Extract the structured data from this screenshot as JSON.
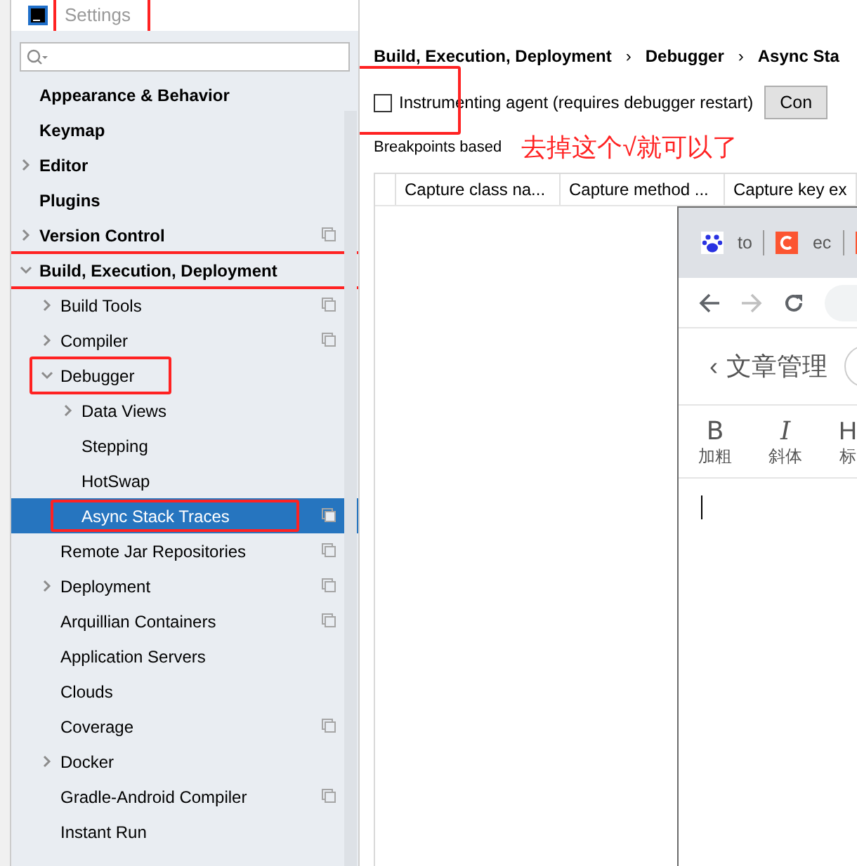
{
  "window": {
    "title": "Settings",
    "annotated": true
  },
  "tree": [
    {
      "label": "Appearance & Behavior"
    },
    {
      "label": "Keymap"
    },
    {
      "label": "Editor",
      "expandable": true,
      "expanded": false
    },
    {
      "label": "Plugins"
    },
    {
      "label": "Version Control",
      "expandable": true,
      "expanded": false,
      "project": true
    },
    {
      "label": "Build, Execution, Deployment",
      "expandable": true,
      "expanded": true,
      "annotated": true,
      "children": [
        {
          "label": "Build Tools",
          "expandable": true,
          "expanded": false,
          "project": true
        },
        {
          "label": "Compiler",
          "expandable": true,
          "expanded": false,
          "project": true
        },
        {
          "label": "Debugger",
          "expandable": true,
          "expanded": true,
          "annotated": true,
          "children": [
            {
              "label": "Data Views",
              "expandable": true,
              "expanded": false
            },
            {
              "label": "Stepping"
            },
            {
              "label": "HotSwap"
            },
            {
              "label": "Async Stack Traces",
              "selected": true,
              "project": true,
              "annotated": true
            }
          ]
        },
        {
          "label": "Remote Jar Repositories",
          "project": true
        },
        {
          "label": "Deployment",
          "expandable": true,
          "expanded": false,
          "project": true
        },
        {
          "label": "Arquillian Containers",
          "project": true
        },
        {
          "label": "Application Servers"
        },
        {
          "label": "Clouds"
        },
        {
          "label": "Coverage",
          "project": true
        },
        {
          "label": "Docker",
          "expandable": true,
          "expanded": false
        },
        {
          "label": "Gradle-Android Compiler",
          "project": true
        },
        {
          "label": "Instant Run"
        }
      ]
    }
  ],
  "breadcrumb": [
    "Build, Execution, Deployment",
    "Debugger",
    "Async Sta"
  ],
  "breadcrumb_separator": "›",
  "agent": {
    "label": "Instrumenting agent (requires debugger restart)",
    "checked": false,
    "annotated": true
  },
  "config_button": "Con",
  "section_label": "Breakpoints based",
  "note": "去掉这个√就可以了",
  "table": {
    "columns": [
      "",
      "Capture class na...",
      "Capture method ...",
      "Capture key ex"
    ]
  },
  "browser": {
    "tabs": [
      {
        "label": "to"
      },
      {
        "label": "ec"
      }
    ],
    "back_enabled": true,
    "forward_enabled": false,
    "page_back": "‹",
    "page_title": "文章管理",
    "tools": [
      {
        "glyph": "B",
        "label": "加粗"
      },
      {
        "glyph": "I",
        "label": "斜体"
      },
      {
        "glyph": "H",
        "label": "标"
      }
    ]
  }
}
